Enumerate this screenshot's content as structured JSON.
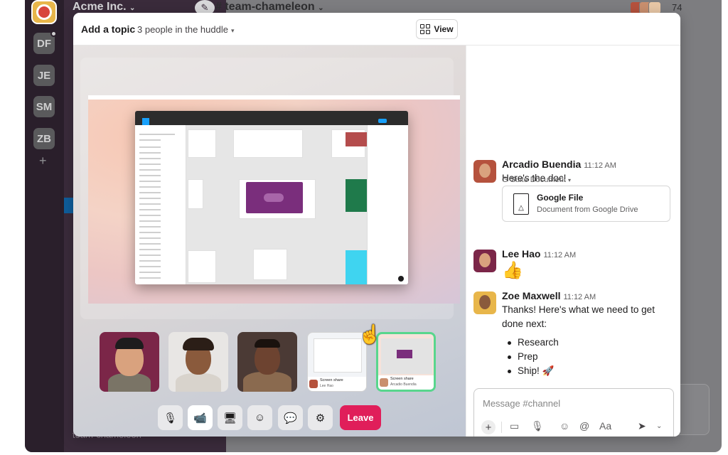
{
  "workspace": {
    "name": "Acme Inc.",
    "workspaces": [
      "DF",
      "JE",
      "SM",
      "ZB"
    ]
  },
  "channel": {
    "title": "# team-chameleon",
    "member_count": "74",
    "bottom_item": "team-chameleon"
  },
  "colors": {
    "aubergine": "#3a2b3b",
    "leave": "#e01e5a",
    "active_tile": "#58d68d"
  },
  "huddle": {
    "add_topic": "Add a topic",
    "people": "3 people in the huddle",
    "view_label": "View",
    "tiles": [
      {
        "kind": "person"
      },
      {
        "kind": "person"
      },
      {
        "kind": "person"
      },
      {
        "kind": "screen-share",
        "title": "Screen share",
        "subtitle": "Lee Hao"
      },
      {
        "kind": "screen-share",
        "title": "Screen share",
        "subtitle": "Arcadio Buendia",
        "active": true
      }
    ],
    "controls": [
      "microphone-icon",
      "video-icon",
      "screen-share-icon",
      "emoji-icon",
      "chat-icon",
      "settings-icon"
    ],
    "leave_label": "Leave"
  },
  "chat": {
    "messages": [
      {
        "author": "Arcadio Buendia",
        "time": "11:12 AM",
        "text": "Here's the doc!",
        "attachment_source": "G Suite Document",
        "attachment": {
          "title": "Google File",
          "subtitle": "Document from Google Drive",
          "icon": "google-drive-icon"
        }
      },
      {
        "author": "Lee Hao",
        "time": "11:12 AM",
        "emoji": "👍"
      },
      {
        "author": "Zoe Maxwell",
        "time": "11:12 AM",
        "text_line1": "Thanks! Here's what we need to get",
        "text_line2": "done next:",
        "bullets": [
          "Research",
          "Prep",
          "Ship! 🚀"
        ]
      }
    ],
    "composer": {
      "placeholder": "Message #channel",
      "format_label": "Aa"
    }
  }
}
